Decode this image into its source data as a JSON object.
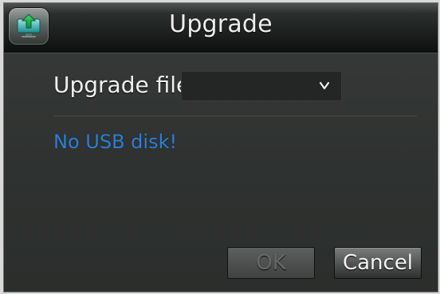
{
  "window": {
    "title": "Upgrade",
    "icon": "upgrade-app-icon"
  },
  "form": {
    "upgrade_file_label": "Upgrade file",
    "upgrade_file_value": "",
    "dropdown_icon": "chevron-down-icon"
  },
  "status": {
    "message": "No USB disk!",
    "color": "#2f7fd6"
  },
  "buttons": {
    "ok_label": "OK",
    "cancel_label": "Cancel"
  },
  "colors": {
    "dialog_background": "#2f3230",
    "title_text": "#eeeeee",
    "label_text": "#f0f0f0",
    "disabled_button_text": "#666967",
    "cancel_button_text": "#f4f4f4"
  }
}
